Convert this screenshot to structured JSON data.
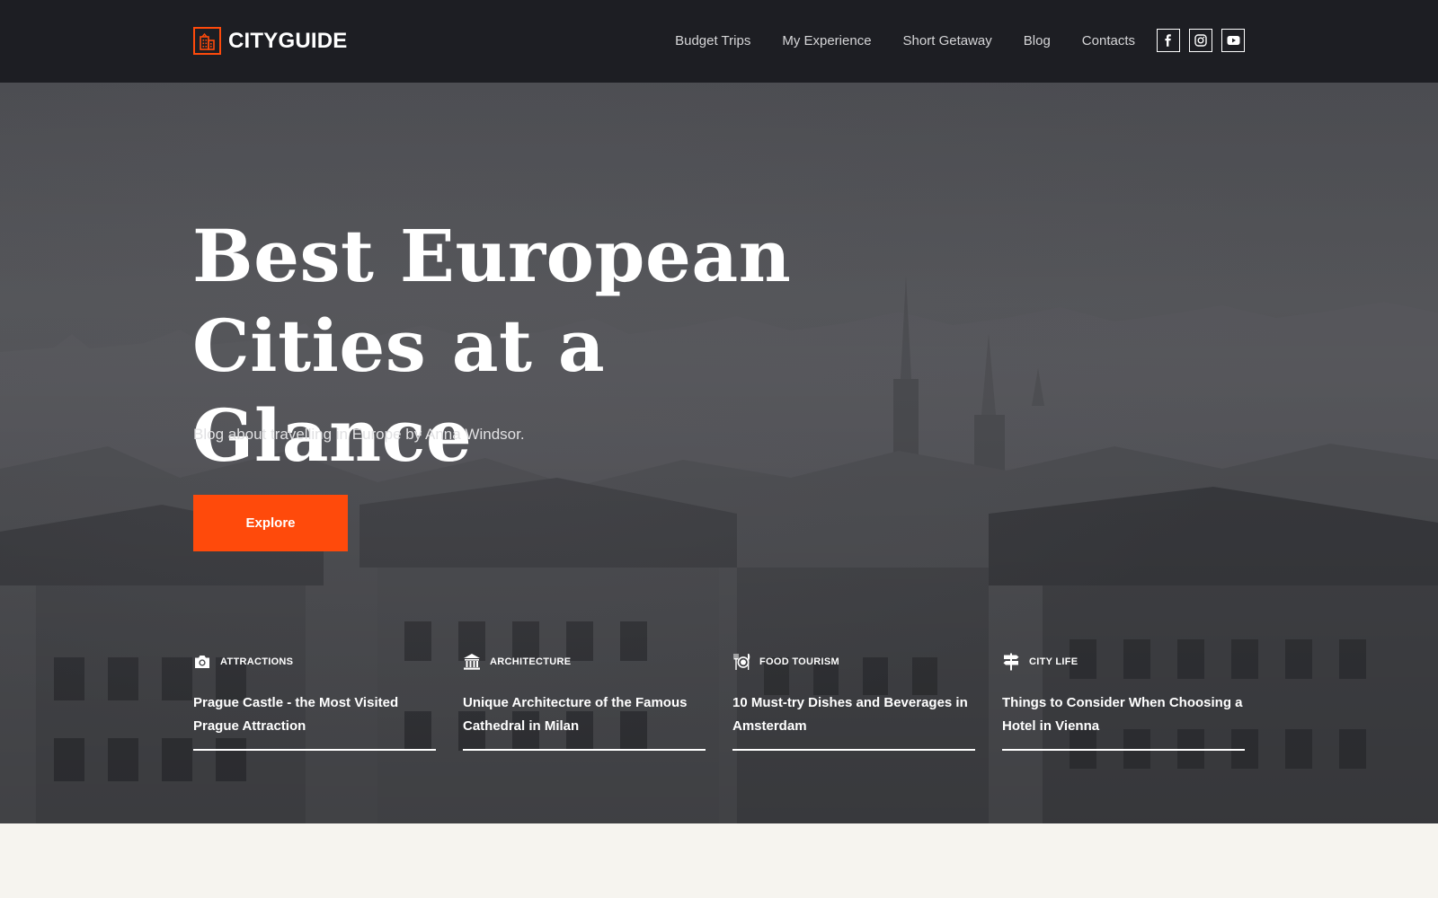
{
  "brand": {
    "name": "CITYGUIDE",
    "accent_color": "#ff4a0b",
    "logo_icon": "building-icon"
  },
  "nav": {
    "items": [
      "Budget Trips",
      "My Experience",
      "Short Getaway",
      "Blog",
      "Contacts"
    ]
  },
  "social": {
    "icons": [
      "facebook-icon",
      "instagram-icon",
      "youtube-icon"
    ]
  },
  "hero": {
    "title_line1": "Best European",
    "title_line2": "Cities at a Glance",
    "subtitle": "Blog about travelling in Europe by Anna Windsor.",
    "cta_label": "Explore"
  },
  "cards": [
    {
      "category": "ATTRACTIONS",
      "icon": "camera-icon",
      "title": "Prague Castle - the Most Visited Prague Attraction"
    },
    {
      "category": "ARCHITECTURE",
      "icon": "museum-icon",
      "title": "Unique Architecture of the Famous Cathedral in Milan"
    },
    {
      "category": "FOOD TOURISM",
      "icon": "dining-icon",
      "title": "10 Must-try Dishes and Beverages in Amsterdam"
    },
    {
      "category": "CITY LIFE",
      "icon": "signpost-icon",
      "title": "Things to Consider When Choosing a Hotel in Vienna"
    }
  ]
}
